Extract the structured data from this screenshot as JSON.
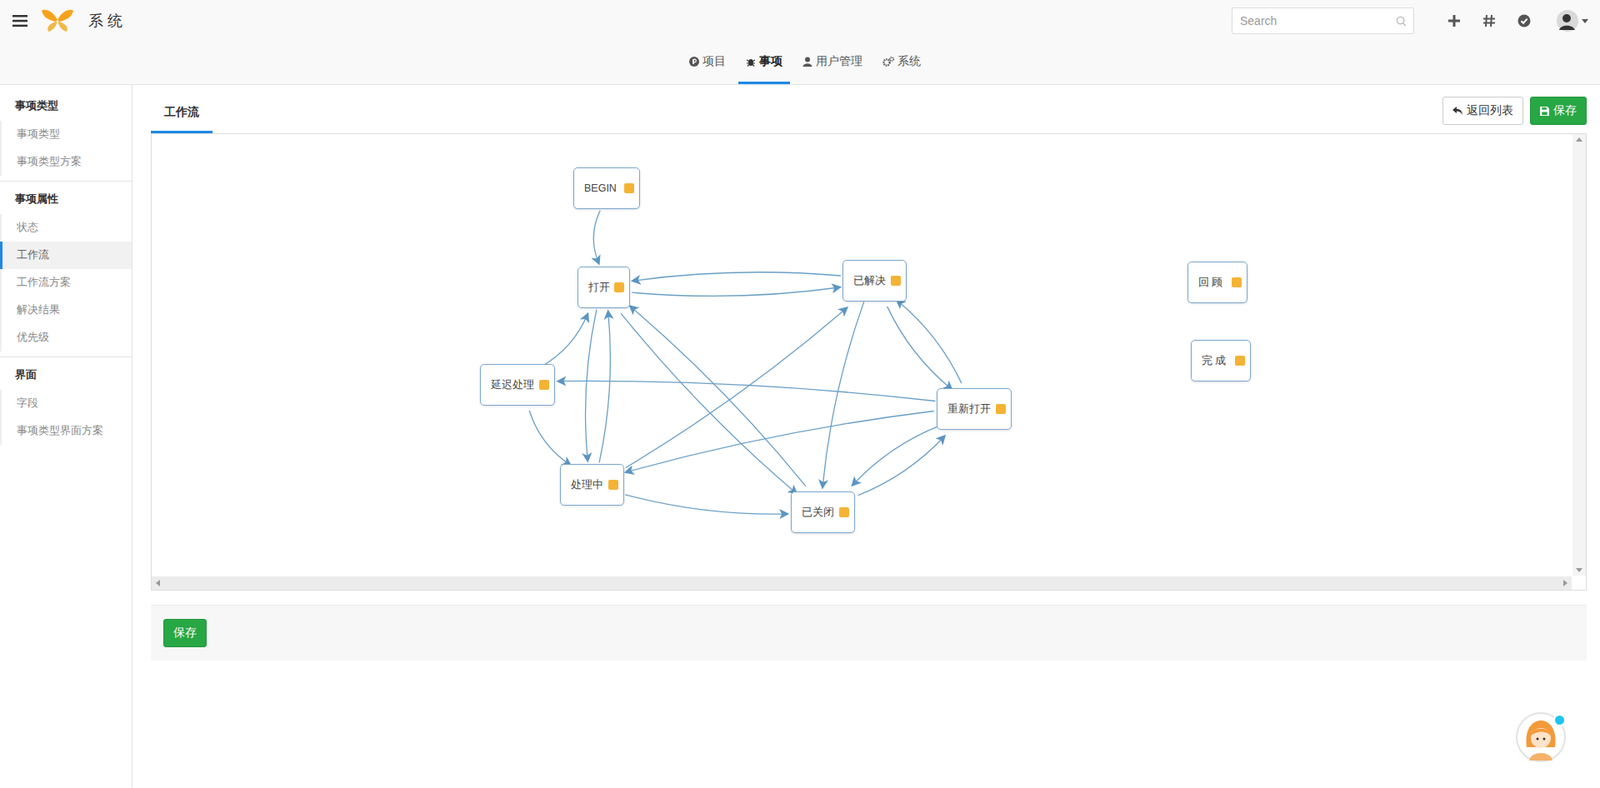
{
  "app": {
    "title": "系 统"
  },
  "search": {
    "placeholder": "Search"
  },
  "nav_tabs": [
    {
      "label": "项目",
      "selected": false
    },
    {
      "label": "事项",
      "selected": true
    },
    {
      "label": "用户管理",
      "selected": false
    },
    {
      "label": "系统",
      "selected": false
    }
  ],
  "sidebar": {
    "groups": [
      {
        "title": "事项类型",
        "items": [
          {
            "label": "事项类型",
            "selected": false
          },
          {
            "label": "事项类型方案",
            "selected": false
          }
        ]
      },
      {
        "title": "事项属性",
        "items": [
          {
            "label": "状态",
            "selected": false
          },
          {
            "label": "工作流",
            "selected": true
          },
          {
            "label": "工作流方案",
            "selected": false
          },
          {
            "label": "解决结果",
            "selected": false
          },
          {
            "label": "优先级",
            "selected": false
          }
        ]
      },
      {
        "title": "界面",
        "items": [
          {
            "label": "字段",
            "selected": false
          },
          {
            "label": "事项类型界面方案",
            "selected": false
          }
        ]
      }
    ]
  },
  "page_tabs": [
    {
      "label": "工作流",
      "selected": true
    }
  ],
  "buttons": {
    "back": "返回列表",
    "save_top": "保存",
    "save_bottom": "保存"
  },
  "workflow": {
    "nodes": [
      {
        "label": "BEGIN"
      },
      {
        "label": "打开"
      },
      {
        "label": "已解决"
      },
      {
        "label": "回 顾"
      },
      {
        "label": "完 成"
      },
      {
        "label": "延迟处理"
      },
      {
        "label": "重新打开"
      },
      {
        "label": "处理中"
      },
      {
        "label": "已关闭"
      }
    ],
    "edges": [
      {
        "from": "BEGIN",
        "to": "打开"
      },
      {
        "from": "打开",
        "to": "已解决"
      },
      {
        "from": "已解决",
        "to": "打开"
      },
      {
        "from": "打开",
        "to": "处理中"
      },
      {
        "from": "处理中",
        "to": "打开"
      },
      {
        "from": "延迟处理",
        "to": "打开"
      },
      {
        "from": "延迟处理",
        "to": "处理中"
      },
      {
        "from": "打开",
        "to": "已关闭"
      },
      {
        "from": "已关闭",
        "to": "打开"
      },
      {
        "from": "处理中",
        "to": "已解决"
      },
      {
        "from": "重新打开",
        "to": "处理中"
      },
      {
        "from": "已解决",
        "to": "已关闭"
      },
      {
        "from": "已解决",
        "to": "重新打开"
      },
      {
        "from": "重新打开",
        "to": "已解决"
      },
      {
        "from": "重新打开",
        "to": "延迟处理"
      },
      {
        "from": "处理中",
        "to": "已关闭"
      },
      {
        "from": "已关闭",
        "to": "重新打开"
      },
      {
        "from": "重新打开",
        "to": "已关闭"
      }
    ]
  }
}
